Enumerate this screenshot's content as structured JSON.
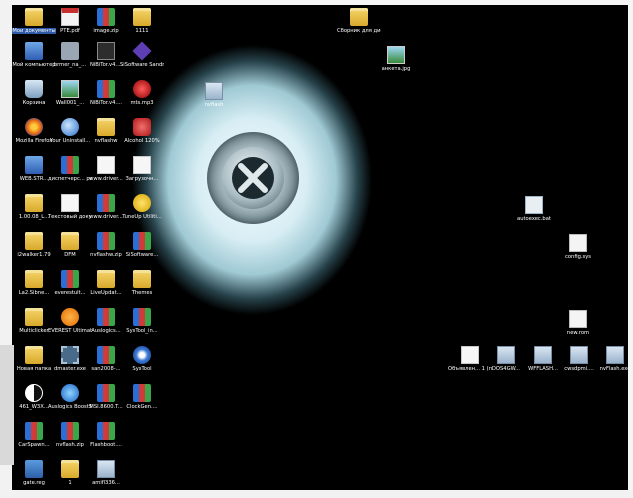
{
  "desktop": {
    "icons": [
      {
        "label": "Мои документы",
        "icon": "folder",
        "sel": true
      },
      {
        "label": "PTE.pdf",
        "icon": "pdf"
      },
      {
        "label": "image.zip",
        "icon": "rar"
      },
      {
        "label": "1111",
        "icon": "folder"
      },
      {
        "label": "Сборник для дистр...",
        "icon": "folder"
      },
      {
        "label": "Мой компьютер",
        "icon": "pc"
      },
      {
        "label": "brmer_na_...",
        "icon": "printer"
      },
      {
        "label": "NiBiTor.v4....",
        "icon": "zip7"
      },
      {
        "label": "SiSoftware Sandra P...",
        "icon": "purple"
      },
      {
        "label": "анкета.jpg",
        "icon": "img"
      },
      {
        "label": "nvflash",
        "icon": "screen"
      },
      {
        "label": "Корзина",
        "icon": "bin"
      },
      {
        "label": "Wall001_...",
        "icon": "img"
      },
      {
        "label": "NiBiTor.v4....",
        "icon": "rar"
      },
      {
        "label": "mts.mp3",
        "icon": "red"
      },
      {
        "label": "Mozilla Firefox",
        "icon": "firefox"
      },
      {
        "label": "Your Uninstall...",
        "icon": "globe"
      },
      {
        "label": "nvflashw",
        "icon": "folder"
      },
      {
        "label": "Alcohol 120%",
        "icon": "alcohol"
      },
      {
        "label": "WEB.STR...",
        "icon": "pc"
      },
      {
        "label": "диспетчерс... радиосвяз...",
        "icon": "rar"
      },
      {
        "label": "www.driver...",
        "icon": "doc"
      },
      {
        "label": "Загрузочн...",
        "icon": "doc"
      },
      {
        "label": "1.00.08_L...",
        "icon": "folder"
      },
      {
        "label": "Текстовый документ.txt",
        "icon": "doc"
      },
      {
        "label": "www.driver...",
        "icon": "rar"
      },
      {
        "label": "TuneUp Utiliti...",
        "icon": "tuneup"
      },
      {
        "label": "autoexec.bat",
        "icon": "batch"
      },
      {
        "label": "i2walker1.79",
        "icon": "folder"
      },
      {
        "label": "DFM",
        "icon": "folder"
      },
      {
        "label": "nvflashw.zip",
        "icon": "rar"
      },
      {
        "label": "SiSoftware...",
        "icon": "rar"
      },
      {
        "label": "config.sys",
        "icon": "sys"
      },
      {
        "label": "La2.Sibne...",
        "icon": "folder"
      },
      {
        "label": "everestult...",
        "icon": "rar"
      },
      {
        "label": "LiveUpdat...",
        "icon": "folder"
      },
      {
        "label": "Themes",
        "icon": "folder"
      },
      {
        "label": "Multiclicker",
        "icon": "folder"
      },
      {
        "label": "EVEREST Ultimate...",
        "icon": "orange"
      },
      {
        "label": "Auslogics...",
        "icon": "rar"
      },
      {
        "label": "SysTool_in...",
        "icon": "rar"
      },
      {
        "label": "new.rom",
        "icon": "sys"
      },
      {
        "label": "Новая папка",
        "icon": "folder"
      },
      {
        "label": "dmaster.exe",
        "icon": "cpu"
      },
      {
        "label": "san2008-...",
        "icon": "rar"
      },
      {
        "label": "SysTool",
        "icon": "gear"
      },
      {
        "label": "Объявлен... 1 (притча...",
        "icon": "doc"
      },
      {
        "label": "DOS4GW...",
        "icon": "screen"
      },
      {
        "label": "WFFLASH...",
        "icon": "screen"
      },
      {
        "label": "cwsdpmi....",
        "icon": "screen"
      },
      {
        "label": "nvFlash.exe",
        "icon": "screen"
      },
      {
        "label": "461_W3X...",
        "icon": "yinyang"
      },
      {
        "label": "Auslogics BoostSpeed",
        "icon": "blueball"
      },
      {
        "label": "MSI.8600.T...",
        "icon": "rar"
      },
      {
        "label": "ClockGen....",
        "icon": "rar"
      },
      {
        "label": "CarSpawn...",
        "icon": "rar"
      },
      {
        "label": "nvflash.zip",
        "icon": "rar"
      },
      {
        "label": "Flashboot....",
        "icon": "rar"
      },
      {
        "label": "gate.reg",
        "icon": "reg"
      },
      {
        "label": "1",
        "icon": "folder"
      },
      {
        "label": "amifl336...",
        "icon": "screen"
      }
    ]
  }
}
